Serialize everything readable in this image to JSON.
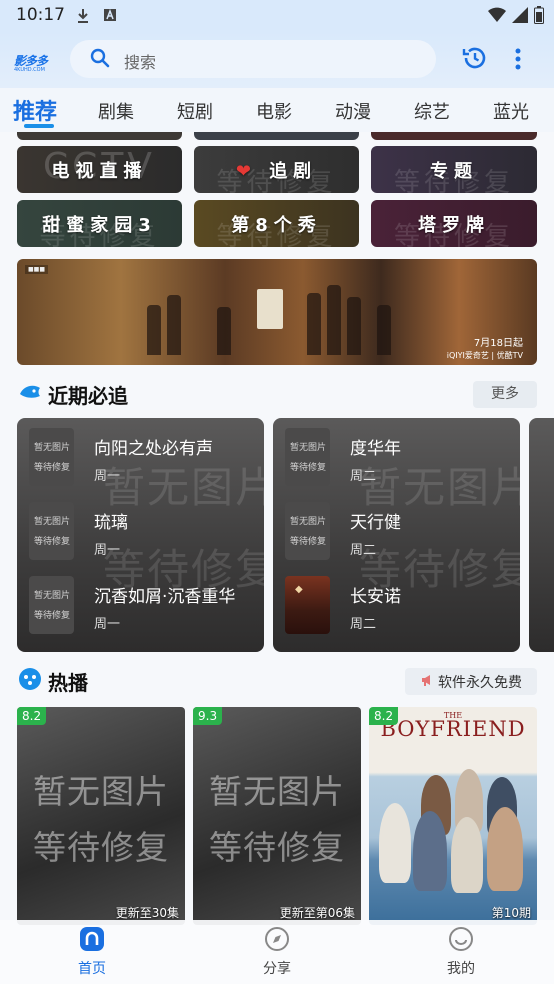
{
  "status_bar": {
    "time": "10:17"
  },
  "header": {
    "logo_text": "影多多",
    "logo_sub": "4KUHD.COM",
    "search_placeholder": "搜索"
  },
  "tabs": [
    {
      "label": "推荐",
      "active": true
    },
    {
      "label": "剧集"
    },
    {
      "label": "短剧"
    },
    {
      "label": "电影"
    },
    {
      "label": "动漫"
    },
    {
      "label": "综艺"
    },
    {
      "label": "蓝光"
    }
  ],
  "quick_tiles": [
    {
      "label": "电视直播",
      "watermark": "CCTV"
    },
    {
      "label": "追剧",
      "watermark": "等待修复"
    },
    {
      "label": "专题",
      "watermark": "等待修复"
    },
    {
      "label": "甜蜜家园3",
      "watermark": "等待修复"
    },
    {
      "label": "第8个秀",
      "watermark": "等待修复"
    },
    {
      "label": "塔罗牌",
      "watermark": "等待修复"
    }
  ],
  "banner": {
    "date_text": "7月18日起",
    "brand_text": "iQIYI爱奇艺 | 优酷TV"
  },
  "recent": {
    "title": "近期必追",
    "more_label": "更多",
    "placeholder_line1": "暂无图片",
    "placeholder_line2": "等待修复",
    "card_watermark_1": "暂无图片",
    "card_watermark_2": "等待修复",
    "cards": [
      {
        "items": [
          {
            "title": "向阳之处必有声",
            "day": "周一"
          },
          {
            "title": "琉璃",
            "day": "周一"
          },
          {
            "title": "沉香如屑·沉香重华",
            "day": "周一"
          }
        ]
      },
      {
        "items": [
          {
            "title": "度华年",
            "day": "周二"
          },
          {
            "title": "天行健",
            "day": "周二"
          },
          {
            "title": "长安诺",
            "day": "周二"
          }
        ]
      }
    ]
  },
  "hot": {
    "title": "热播",
    "badge_label": "软件永久免费",
    "placeholder_line1": "暂无图片",
    "placeholder_line2": "等待修复",
    "items": [
      {
        "rating": "8.2",
        "episode": "更新至30集"
      },
      {
        "rating": "9.3",
        "episode": "更新至第06集"
      },
      {
        "rating": "8.2",
        "episode": "第10期",
        "poster_title": "BOYFRIEND",
        "poster_the": "THE"
      }
    ]
  },
  "bottom_nav": [
    {
      "label": "首页",
      "active": true
    },
    {
      "label": "分享"
    },
    {
      "label": "我的"
    }
  ]
}
